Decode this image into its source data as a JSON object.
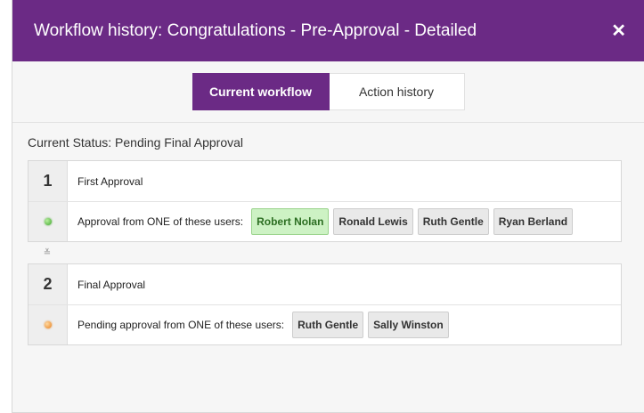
{
  "modal": {
    "title": "Workflow history: Congratulations - Pre-Approval - Detailed",
    "close_label": "✕"
  },
  "tabs": [
    {
      "label": "Current workflow",
      "active": true
    },
    {
      "label": "Action history",
      "active": false
    }
  ],
  "status": {
    "text": "Current Status: Pending  Final Approval"
  },
  "connector_icon": "≚",
  "steps": [
    {
      "number": "1",
      "name": "First Approval",
      "status_icon": "green-dot",
      "approval_text": "Approval from ONE of these users:",
      "users": [
        "Robert Nolan",
        "Ronald Lewis",
        "Ruth Gentle",
        "Ryan Berland"
      ]
    },
    {
      "number": "2",
      "name": "Final Approval",
      "status_icon": "orange-dot",
      "approval_text": "Pending approval from ONE of these users:",
      "users": [
        "Ruth Gentle",
        "Sally Winston"
      ]
    }
  ],
  "colors": {
    "header_bg": "#6b2a85",
    "approved_chip_bg": "#cdf2c4",
    "approved_status": "#3fa52c",
    "pending_status": "#e8801f"
  }
}
